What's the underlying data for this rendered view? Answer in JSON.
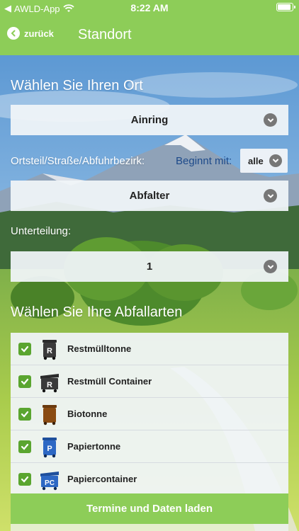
{
  "status_bar": {
    "app_name": "AWLD-App",
    "time": "8:22 AM"
  },
  "nav": {
    "back_label": "zurück",
    "title": "Standort"
  },
  "location": {
    "heading": "Wählen Sie Ihren Ort",
    "place_value": "Ainring",
    "district_label": "Ortsteil/Straße/Abfuhrbezirk:",
    "begins_with_label": "Beginnt mit:",
    "begins_with_value": "alle",
    "district_value": "Abfalter",
    "subdivision_label": "Unterteilung:",
    "subdivision_value": "1"
  },
  "waste": {
    "heading": "Wählen Sie Ihre Abfallarten",
    "items": [
      {
        "label": "Restmülltonne",
        "checked": true,
        "icon": "restmuell-bin-icon",
        "letter": "R"
      },
      {
        "label": "Restmüll Container",
        "checked": true,
        "icon": "restmuell-container-icon",
        "letter": "R"
      },
      {
        "label": "Biotonne",
        "checked": true,
        "icon": "bio-bin-icon",
        "letter": ""
      },
      {
        "label": "Papiertonne",
        "checked": true,
        "icon": "paper-bin-icon",
        "letter": "P"
      },
      {
        "label": "Papiercontainer",
        "checked": true,
        "icon": "paper-container-icon",
        "letter": "PC"
      }
    ]
  },
  "actions": {
    "load_label": "Termine und Daten laden"
  },
  "colors": {
    "accent_green": "#8dcd58",
    "checkbox_green": "#5aa52f",
    "link_blue": "#1d4a8a"
  }
}
